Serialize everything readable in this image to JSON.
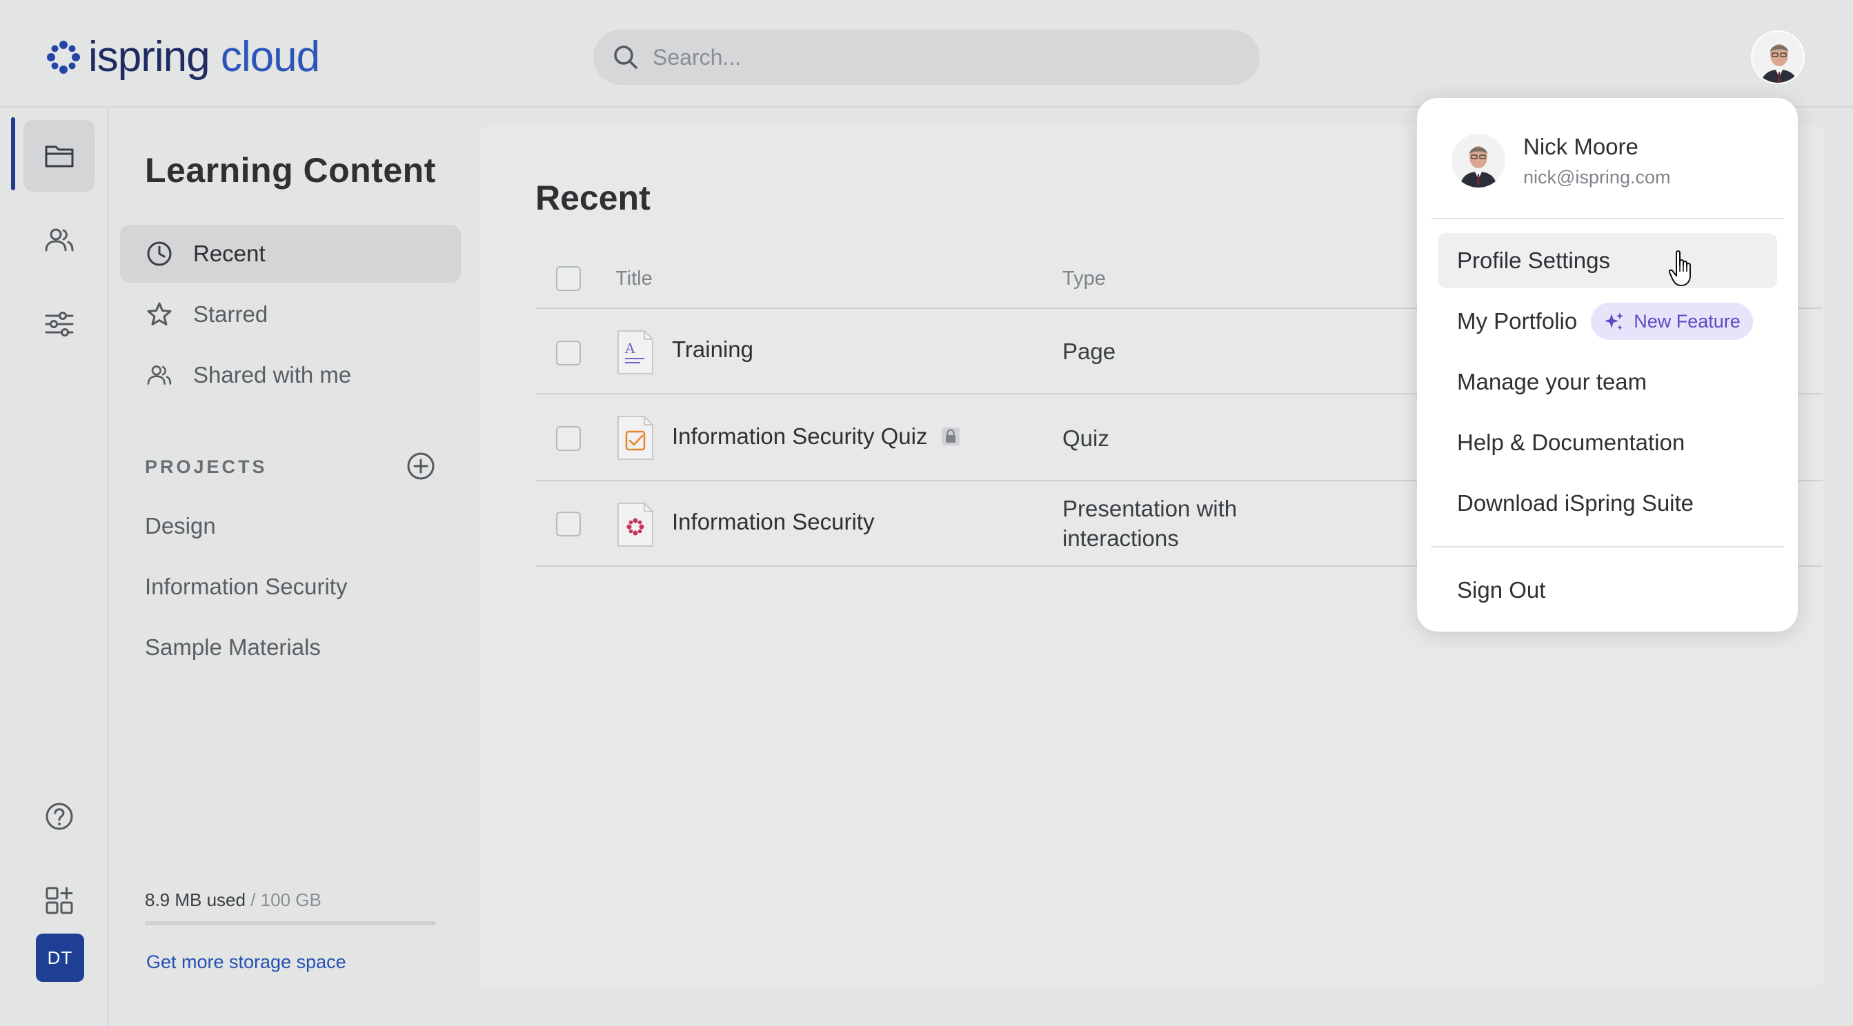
{
  "header": {
    "logo_left": "ispring",
    "logo_right": " cloud",
    "search_placeholder": "Search..."
  },
  "rail": {
    "items": [
      "folder-icon",
      "users-icon",
      "sliders-icon",
      "help-icon",
      "apps-icon"
    ],
    "account_initials": "DT"
  },
  "nav": {
    "title": "Learning Content",
    "items": [
      {
        "label": "Recent",
        "icon": "clock-icon"
      },
      {
        "label": "Starred",
        "icon": "star-icon"
      },
      {
        "label": "Shared with me",
        "icon": "users-icon"
      }
    ],
    "projects_label": "PROJECTS",
    "projects": [
      "Design",
      "Information Security",
      "Sample Materials"
    ],
    "storage_used": "8.9 MB used",
    "storage_limit": " / 100 GB",
    "storage_fraction": 0.0001,
    "more_storage": "Get more storage space"
  },
  "main": {
    "title": "Recent",
    "columns": {
      "title": "Title",
      "type": "Type"
    },
    "rows": [
      {
        "title": "Training",
        "type": "Page",
        "icon": "page-file-icon"
      },
      {
        "title": "Information Security Quiz",
        "type": "Quiz",
        "icon": "quiz-file-icon",
        "locked": true
      },
      {
        "title": "Information Security",
        "type": "Presentation with interactions",
        "type_line1": "Presentation with",
        "type_line2": "interactions",
        "icon": "presentation-file-icon"
      }
    ]
  },
  "menu": {
    "user_name": "Nick Moore",
    "user_email": "nick@ispring.com",
    "items": {
      "profile": "Profile Settings",
      "portfolio": "My Portfolio",
      "new_feature": "New Feature",
      "team": "Manage your team",
      "help": "Help & Documentation",
      "download": "Download iSpring Suite",
      "signout": "Sign Out"
    }
  },
  "colors": {
    "brand": "#2b55b8",
    "accent": "#243a8c",
    "badge": "#5b4bc4"
  }
}
